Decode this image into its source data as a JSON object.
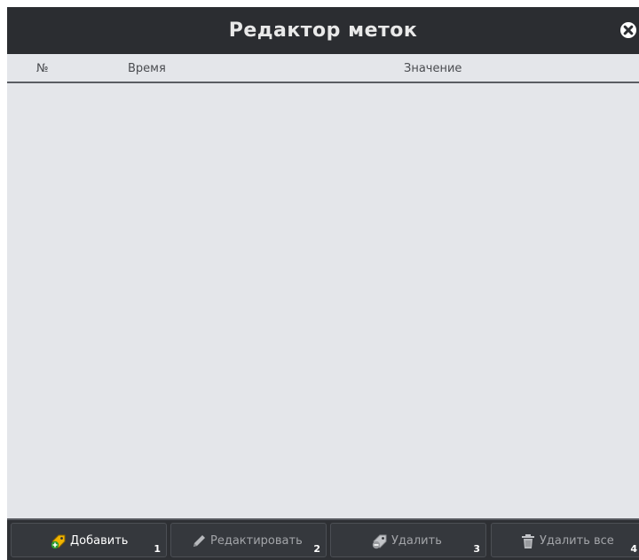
{
  "window": {
    "title": "Редактор меток"
  },
  "table": {
    "columns": [
      "№",
      "Время",
      "Значение"
    ],
    "rows": []
  },
  "toolbar": {
    "buttons": [
      {
        "label": "Добавить",
        "shortcut": "1",
        "enabled": true,
        "icon": "tag-add-icon"
      },
      {
        "label": "Редактировать",
        "shortcut": "2",
        "enabled": false,
        "icon": "pencil-icon"
      },
      {
        "label": "Удалить",
        "shortcut": "3",
        "enabled": false,
        "icon": "tag-remove-icon"
      },
      {
        "label": "Удалить все",
        "shortcut": "4",
        "enabled": false,
        "icon": "trash-icon"
      }
    ]
  },
  "colors": {
    "titlebar": "#2b2d31",
    "list_background": "#e4e6ea",
    "accent": "#f0b400"
  }
}
